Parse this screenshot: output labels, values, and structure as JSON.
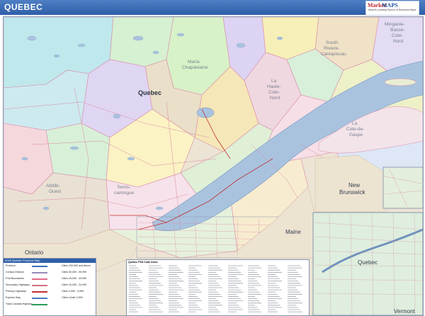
{
  "header": {
    "title": "QUEBEC",
    "brand_color": "#3566b0"
  },
  "logo": {
    "line1": "Market",
    "line2": "MAPS",
    "tagline": "World's Leading Source of Business Maps"
  },
  "map": {
    "water_color": "#a9c3df",
    "land_color": "#ede3d1",
    "labels": {
      "quebec": "Quebec",
      "ontario": "Ontario",
      "maine": "Maine",
      "new_brunswick_1": "New",
      "new_brunswick_2": "Brunswick",
      "vermont": "Vermont",
      "maria_1": "Maria-",
      "maria_2": "Chapdelaine",
      "riviere_1": "South",
      "riviere_2": "Riviere-",
      "riviere_3": "Caniapiscau",
      "minganie_1": "Minganie-",
      "minganie_2": "Basse-",
      "minganie_3": "Cote-",
      "minganie_4": "Nord",
      "haute_1": "La",
      "haute_2": "Haute-",
      "haute_3": "Cote-",
      "haute_4": "Nord",
      "abitibi_1": "Abitibi-",
      "abitibi_2": "Ouest",
      "temis_1": "Temis-",
      "temis_2": "camingue",
      "gaspe_1": "La",
      "gaspe_2": "Cote-de-",
      "gaspe_3": "Gaspe",
      "quebec_city": "Quebec"
    }
  },
  "legend": {
    "title": "2018 Quebec Province Map",
    "rows": [
      {
        "name": "Province",
        "color": "#3b6fb6",
        "city": "Cities 100,000 and Above"
      },
      {
        "name": "Census Division",
        "color": "#9a8ab8",
        "city": "Cities 50,000 - 99,999"
      },
      {
        "name": "FSA Boundaries",
        "color": "#e06a8a",
        "city": "Cities 25,000 - 49,999"
      },
      {
        "name": "Secondary Highways",
        "color": "#d07080",
        "city": "Cities 10,000 - 24,999"
      },
      {
        "name": "Primary Highways",
        "color": "#c03030",
        "city": "Cities 2,500 - 9,999"
      },
      {
        "name": "Express Way",
        "color": "#4a7bc4",
        "city": "Cities Under 2,500"
      },
      {
        "name": "Trans Canada Highway",
        "color": "#2a9c5a",
        "city": ""
      }
    ]
  },
  "index": {
    "title": "Quebec FSA Code Index"
  }
}
